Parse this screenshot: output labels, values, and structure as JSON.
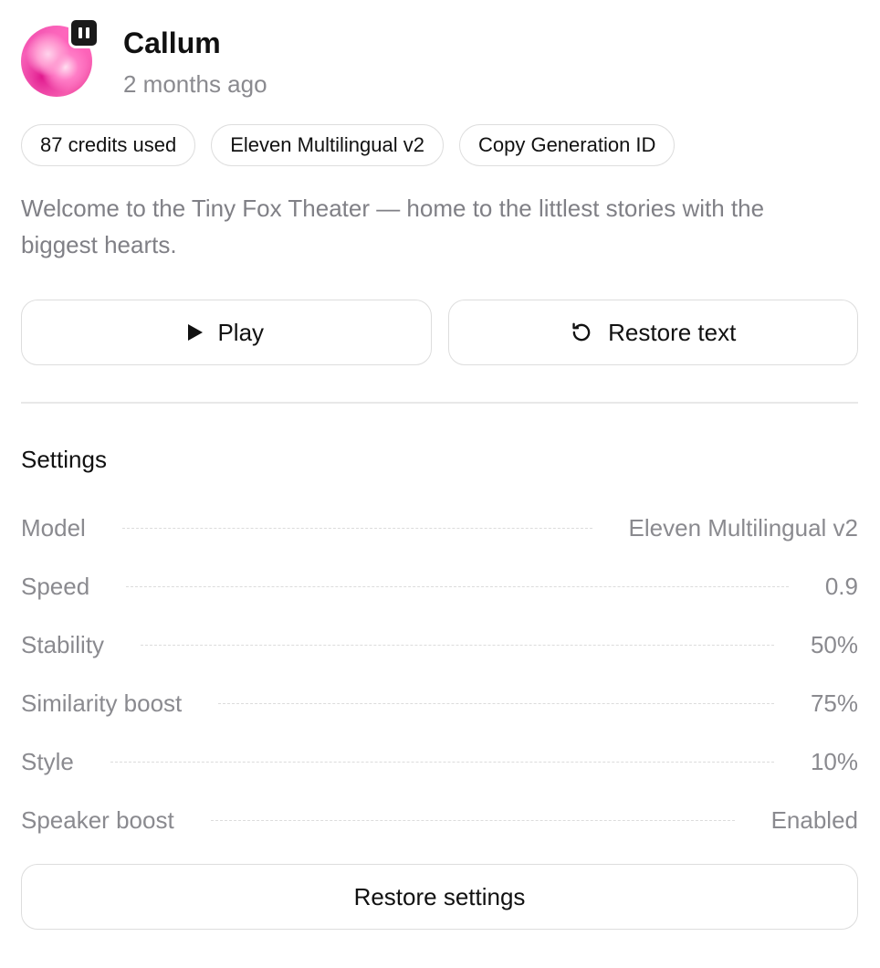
{
  "voice": {
    "name": "Callum",
    "time": "2 months ago",
    "avatar_icon": "pink-gradient-avatar",
    "badge_icon": "pause-icon"
  },
  "chips": {
    "credits": "87 credits used",
    "model": "Eleven Multilingual v2",
    "copy_id": "Copy Generation ID"
  },
  "description": "Welcome to the Tiny Fox Theater — home to the littlest stories with the biggest hearts.",
  "actions": {
    "play_label": "Play",
    "play_icon": "play-icon",
    "restore_text_label": "Restore text",
    "restore_icon": "restore-icon"
  },
  "settings": {
    "title": "Settings",
    "rows": [
      {
        "label": "Model",
        "value": "Eleven Multilingual v2"
      },
      {
        "label": "Speed",
        "value": "0.9"
      },
      {
        "label": "Stability",
        "value": "50%"
      },
      {
        "label": "Similarity boost",
        "value": "75%"
      },
      {
        "label": "Style",
        "value": "10%"
      },
      {
        "label": "Speaker boost",
        "value": "Enabled"
      }
    ],
    "restore_label": "Restore settings"
  },
  "colors": {
    "text_primary": "#111111",
    "text_secondary": "#8a8a8f",
    "border": "#dddddd",
    "avatar_pink": "#ef3fa6"
  }
}
